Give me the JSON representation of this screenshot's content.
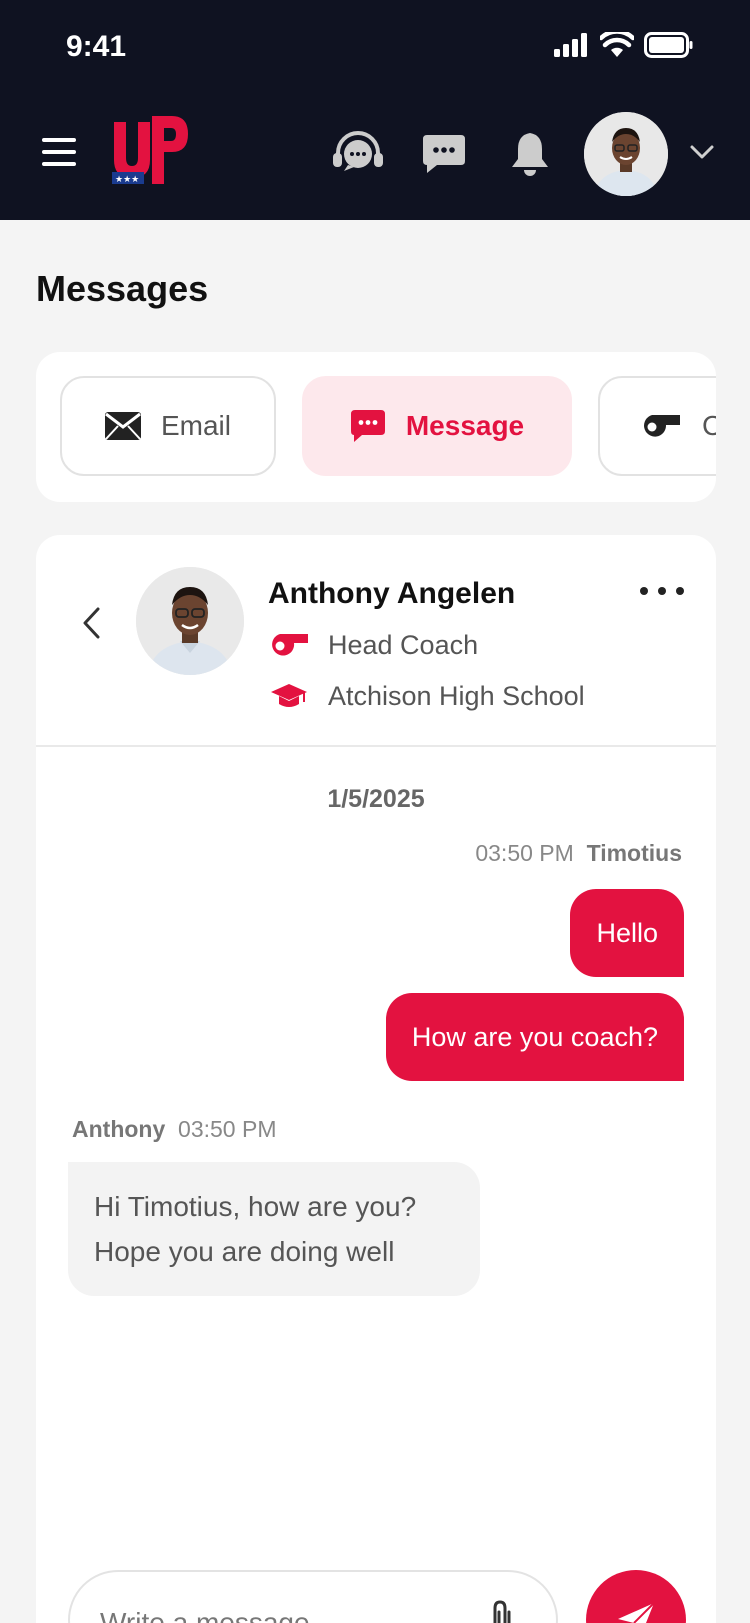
{
  "status_bar": {
    "time": "9:41"
  },
  "header": {
    "logo_text": "UP",
    "nav_icons": [
      "support-headset-icon",
      "chat-icon",
      "bell-icon"
    ]
  },
  "page": {
    "title": "Messages"
  },
  "tabs": [
    {
      "label": "Email",
      "icon": "envelope-icon",
      "active": false
    },
    {
      "label": "Message",
      "icon": "chat-bubble-icon",
      "active": true
    },
    {
      "label": "C",
      "icon": "whistle-icon",
      "active": false
    }
  ],
  "contact": {
    "name": "Anthony Angelen",
    "role": "Head Coach",
    "school": "Atchison High School"
  },
  "conversation": {
    "date": "1/5/2025",
    "outgoing": {
      "time": "03:50 PM",
      "sender": "Timotius",
      "messages": [
        "Hello",
        "How are you coach?"
      ]
    },
    "incoming": {
      "sender": "Anthony",
      "time": "03:50 PM",
      "lines": [
        "Hi Timotius, how are you?",
        "Hope you are doing well"
      ]
    }
  },
  "composer": {
    "placeholder": "Write a message..."
  },
  "colors": {
    "header_bg": "#0f1221",
    "accent": "#e31240",
    "accent_soft": "#fde8ec",
    "page_bg": "#f4f4f4",
    "card_bg": "#ffffff"
  }
}
